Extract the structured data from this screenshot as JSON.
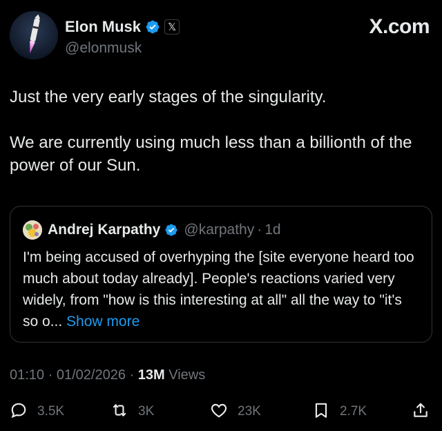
{
  "author": {
    "name": "Elon Musk",
    "handle": "@elonmusk",
    "affiliate_badge": "𝕏"
  },
  "brand": "X.com",
  "tweet": {
    "text": "Just the very early stages of the singularity.\n\nWe are currently using much less than a billionth of the power of our Sun."
  },
  "quote": {
    "name": "Andrej Karpathy",
    "handle": "@karpathy",
    "separator": "·",
    "time": "1d",
    "text": "I'm being accused of overhyping the [site everyone heard too much about today already]. People's reactions varied very widely, from \"how is this interesting at all\" all the way to \"it's so o...",
    "show_more": "Show more"
  },
  "meta": {
    "time": "01:10",
    "sep1": "·",
    "date": "01/02/2026",
    "sep2": "·",
    "views_count": "13M",
    "views_label": "Views"
  },
  "actions": {
    "replies": "3.5K",
    "reposts": "3K",
    "likes": "23K",
    "bookmarks": "2.7K"
  },
  "colors": {
    "background": "#000000",
    "text": "#e7e9ea",
    "secondary": "#71767b",
    "accent": "#1d9bf0",
    "border": "#2f3336"
  },
  "icons": [
    "verified-badge-icon",
    "x-logo-icon",
    "reply-icon",
    "repost-icon",
    "like-icon",
    "bookmark-icon",
    "share-icon"
  ]
}
